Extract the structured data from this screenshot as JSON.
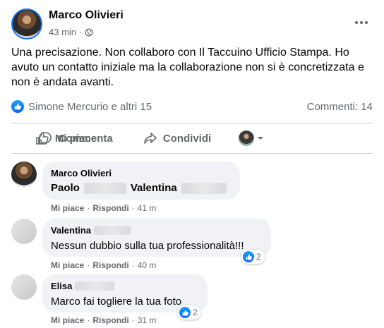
{
  "post": {
    "author": "Marco Olivieri",
    "time": "43 min",
    "separator": "·",
    "text": "Una precisazione. Non collaboro con Il Taccuino Ufficio Stampa. Ho avuto un contatto iniziale ma la collaborazione non si è concretizzata e non è andata avanti.",
    "reactions_text": "Simone Mercurio e altri 15",
    "comments_count": "Commenti: 14"
  },
  "actions": {
    "like": "Mi piace",
    "comment": "Commenta",
    "share": "Condividi"
  },
  "comments": [
    {
      "name": "Marco Olivieri",
      "text_a": "Paolo",
      "text_b": "Valentina",
      "like": "Mi piace",
      "reply": "Rispondi",
      "time": "41 m"
    },
    {
      "name": "Valentina",
      "text": "Nessun dubbio sulla tua professionalità!!!",
      "like": "Mi piace",
      "reply": "Rispondi",
      "time": "40 m",
      "reactions": "2"
    },
    {
      "name": "Elisa",
      "text": "Marco fai togliere la tua foto",
      "like": "Mi piace",
      "reply": "Rispondi",
      "time": "31 m",
      "reactions": "2"
    }
  ],
  "meta_separator": "·",
  "colors": {
    "accent": "#1877f2",
    "muted": "#65676b",
    "bubble": "#f0f2f5"
  },
  "icons": [
    "globe-icon",
    "more-icon",
    "like-icon",
    "comment-icon",
    "share-icon",
    "chevron-down-icon"
  ]
}
